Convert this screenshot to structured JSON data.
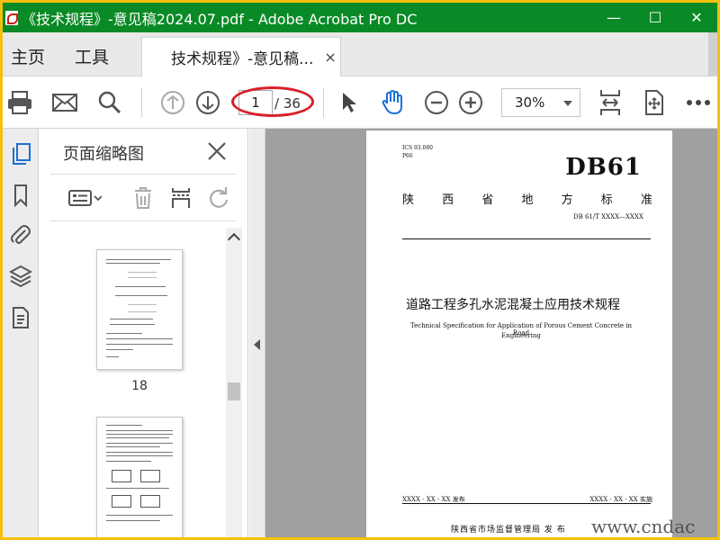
{
  "window": {
    "title": "《技术规程》-意见稿2024.07.pdf - Adobe Acrobat Pro DC",
    "minimize": "—",
    "maximize": "☐",
    "close": "✕"
  },
  "menu": {
    "home": "主页",
    "tools": "工具",
    "tab_label": "技术规程》-意见稿...",
    "tab_close": "×"
  },
  "toolbar": {
    "current_page": "1",
    "total_pages": "/ 36",
    "zoom": "30%"
  },
  "panel": {
    "title": "页面缩略图",
    "thumbnails": [
      {
        "label": "18"
      }
    ]
  },
  "page": {
    "ics": "ICS 93.080",
    "classification": "P66",
    "standard_code": "DB61",
    "province_chars": [
      "陕",
      "西",
      "省",
      "地",
      "方",
      "标",
      "准"
    ],
    "doc_number": "DB 61/T XXXX—XXXX",
    "title_cn": "道路工程多孔水泥混凝土应用技术规程",
    "title_en_1": "Technical Specification for Application of Porous Cement Concrete in Road",
    "title_en_2": "Engineering",
    "publish_date": "XXXX - XX - XX 发布",
    "implement_date": "XXXX - XX - XX 实施",
    "issuer": "陕西省市场监督管理局   发 布"
  },
  "watermark": "www.cndac",
  "colors": {
    "titlebar": "#0a8a26",
    "accent_blue": "#1d6fd6",
    "highlight_red": "#d8202a",
    "border_yellow": "#f4c10f"
  }
}
